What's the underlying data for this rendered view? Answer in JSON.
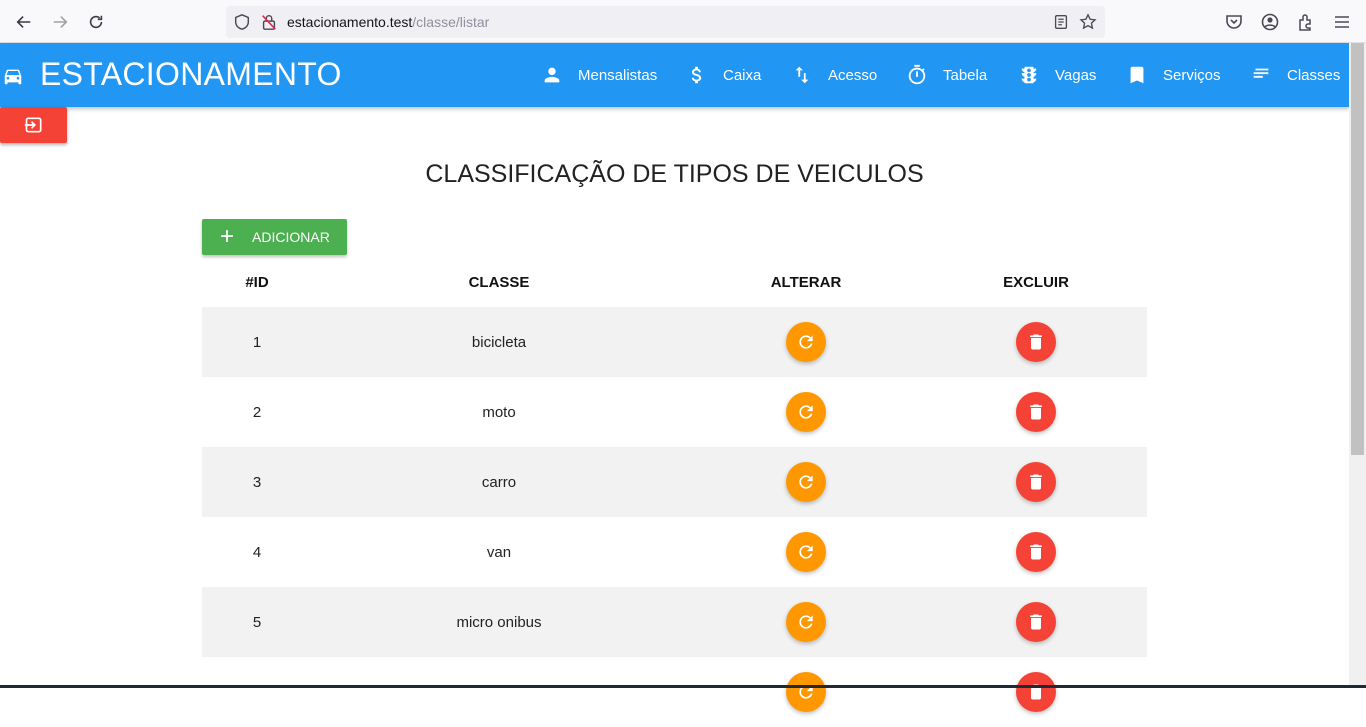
{
  "browser": {
    "url_host": "estacionamento.test",
    "url_path": "/classe/listar"
  },
  "app": {
    "brand": "ESTACIONAMENTO",
    "menu": [
      {
        "label": "Mensalistas",
        "icon": "person-icon"
      },
      {
        "label": "Caixa",
        "icon": "dollar-icon"
      },
      {
        "label": "Acesso",
        "icon": "swap-vertical-icon"
      },
      {
        "label": "Tabela",
        "icon": "timer-icon"
      },
      {
        "label": "Vagas",
        "icon": "traffic-light-icon"
      },
      {
        "label": "Serviços",
        "icon": "bookmark-icon"
      },
      {
        "label": "Classes",
        "icon": "short-text-icon"
      }
    ],
    "accent_color": "#2196f3"
  },
  "main": {
    "title": "CLASSIFICAÇÃO DE TIPOS DE VEICULOS",
    "add_label": "ADICIONAR",
    "table": {
      "headers": {
        "id": "#ID",
        "classe": "CLASSE",
        "alterar": "ALTERAR",
        "excluir": "EXCLUIR"
      },
      "rows": [
        {
          "id": "1",
          "classe": "bicicleta"
        },
        {
          "id": "2",
          "classe": "moto"
        },
        {
          "id": "3",
          "classe": "carro"
        },
        {
          "id": "4",
          "classe": "van"
        },
        {
          "id": "5",
          "classe": "micro onibus"
        },
        {
          "id": "",
          "classe": ""
        }
      ]
    }
  }
}
